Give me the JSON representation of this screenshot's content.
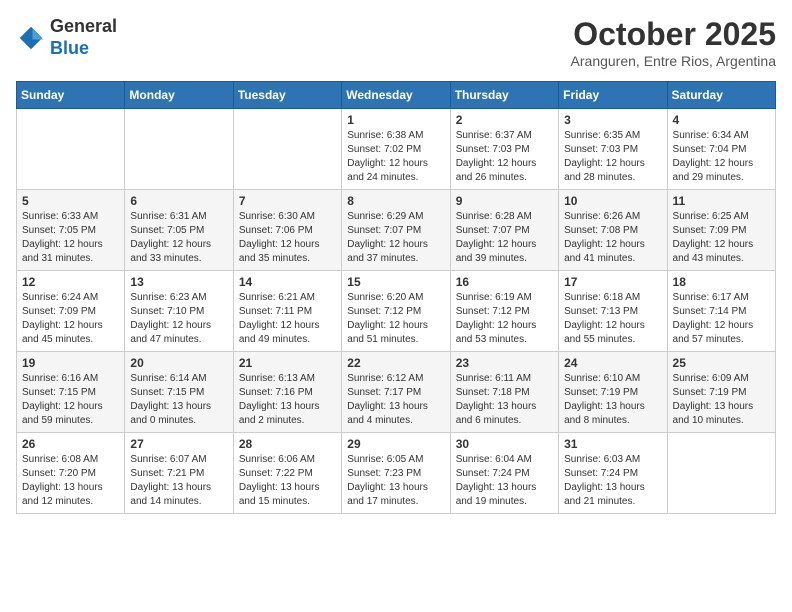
{
  "header": {
    "logo_line1": "General",
    "logo_line2": "Blue",
    "month": "October 2025",
    "location": "Aranguren, Entre Rios, Argentina"
  },
  "weekdays": [
    "Sunday",
    "Monday",
    "Tuesday",
    "Wednesday",
    "Thursday",
    "Friday",
    "Saturday"
  ],
  "weeks": [
    [
      {
        "day": "",
        "info": ""
      },
      {
        "day": "",
        "info": ""
      },
      {
        "day": "",
        "info": ""
      },
      {
        "day": "1",
        "info": "Sunrise: 6:38 AM\nSunset: 7:02 PM\nDaylight: 12 hours\nand 24 minutes."
      },
      {
        "day": "2",
        "info": "Sunrise: 6:37 AM\nSunset: 7:03 PM\nDaylight: 12 hours\nand 26 minutes."
      },
      {
        "day": "3",
        "info": "Sunrise: 6:35 AM\nSunset: 7:03 PM\nDaylight: 12 hours\nand 28 minutes."
      },
      {
        "day": "4",
        "info": "Sunrise: 6:34 AM\nSunset: 7:04 PM\nDaylight: 12 hours\nand 29 minutes."
      }
    ],
    [
      {
        "day": "5",
        "info": "Sunrise: 6:33 AM\nSunset: 7:05 PM\nDaylight: 12 hours\nand 31 minutes."
      },
      {
        "day": "6",
        "info": "Sunrise: 6:31 AM\nSunset: 7:05 PM\nDaylight: 12 hours\nand 33 minutes."
      },
      {
        "day": "7",
        "info": "Sunrise: 6:30 AM\nSunset: 7:06 PM\nDaylight: 12 hours\nand 35 minutes."
      },
      {
        "day": "8",
        "info": "Sunrise: 6:29 AM\nSunset: 7:07 PM\nDaylight: 12 hours\nand 37 minutes."
      },
      {
        "day": "9",
        "info": "Sunrise: 6:28 AM\nSunset: 7:07 PM\nDaylight: 12 hours\nand 39 minutes."
      },
      {
        "day": "10",
        "info": "Sunrise: 6:26 AM\nSunset: 7:08 PM\nDaylight: 12 hours\nand 41 minutes."
      },
      {
        "day": "11",
        "info": "Sunrise: 6:25 AM\nSunset: 7:09 PM\nDaylight: 12 hours\nand 43 minutes."
      }
    ],
    [
      {
        "day": "12",
        "info": "Sunrise: 6:24 AM\nSunset: 7:09 PM\nDaylight: 12 hours\nand 45 minutes."
      },
      {
        "day": "13",
        "info": "Sunrise: 6:23 AM\nSunset: 7:10 PM\nDaylight: 12 hours\nand 47 minutes."
      },
      {
        "day": "14",
        "info": "Sunrise: 6:21 AM\nSunset: 7:11 PM\nDaylight: 12 hours\nand 49 minutes."
      },
      {
        "day": "15",
        "info": "Sunrise: 6:20 AM\nSunset: 7:12 PM\nDaylight: 12 hours\nand 51 minutes."
      },
      {
        "day": "16",
        "info": "Sunrise: 6:19 AM\nSunset: 7:12 PM\nDaylight: 12 hours\nand 53 minutes."
      },
      {
        "day": "17",
        "info": "Sunrise: 6:18 AM\nSunset: 7:13 PM\nDaylight: 12 hours\nand 55 minutes."
      },
      {
        "day": "18",
        "info": "Sunrise: 6:17 AM\nSunset: 7:14 PM\nDaylight: 12 hours\nand 57 minutes."
      }
    ],
    [
      {
        "day": "19",
        "info": "Sunrise: 6:16 AM\nSunset: 7:15 PM\nDaylight: 12 hours\nand 59 minutes."
      },
      {
        "day": "20",
        "info": "Sunrise: 6:14 AM\nSunset: 7:15 PM\nDaylight: 13 hours\nand 0 minutes."
      },
      {
        "day": "21",
        "info": "Sunrise: 6:13 AM\nSunset: 7:16 PM\nDaylight: 13 hours\nand 2 minutes."
      },
      {
        "day": "22",
        "info": "Sunrise: 6:12 AM\nSunset: 7:17 PM\nDaylight: 13 hours\nand 4 minutes."
      },
      {
        "day": "23",
        "info": "Sunrise: 6:11 AM\nSunset: 7:18 PM\nDaylight: 13 hours\nand 6 minutes."
      },
      {
        "day": "24",
        "info": "Sunrise: 6:10 AM\nSunset: 7:19 PM\nDaylight: 13 hours\nand 8 minutes."
      },
      {
        "day": "25",
        "info": "Sunrise: 6:09 AM\nSunset: 7:19 PM\nDaylight: 13 hours\nand 10 minutes."
      }
    ],
    [
      {
        "day": "26",
        "info": "Sunrise: 6:08 AM\nSunset: 7:20 PM\nDaylight: 13 hours\nand 12 minutes."
      },
      {
        "day": "27",
        "info": "Sunrise: 6:07 AM\nSunset: 7:21 PM\nDaylight: 13 hours\nand 14 minutes."
      },
      {
        "day": "28",
        "info": "Sunrise: 6:06 AM\nSunset: 7:22 PM\nDaylight: 13 hours\nand 15 minutes."
      },
      {
        "day": "29",
        "info": "Sunrise: 6:05 AM\nSunset: 7:23 PM\nDaylight: 13 hours\nand 17 minutes."
      },
      {
        "day": "30",
        "info": "Sunrise: 6:04 AM\nSunset: 7:24 PM\nDaylight: 13 hours\nand 19 minutes."
      },
      {
        "day": "31",
        "info": "Sunrise: 6:03 AM\nSunset: 7:24 PM\nDaylight: 13 hours\nand 21 minutes."
      },
      {
        "day": "",
        "info": ""
      }
    ]
  ]
}
